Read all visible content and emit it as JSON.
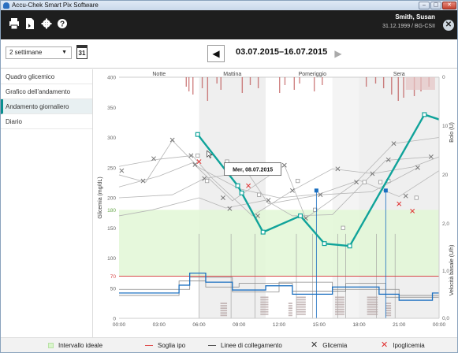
{
  "window": {
    "title": "Accu-Chek Smart Pix Software",
    "btn_min": "–",
    "btn_max": "▢",
    "btn_close": "✕"
  },
  "toolbar": {
    "icons": [
      "printer-icon",
      "pdf-export-icon",
      "gear-icon",
      "help-icon"
    ],
    "user_name": "Smith, Susan",
    "user_info": "31.12.1999 / BG-CSII"
  },
  "range": {
    "selected": "2 settimane",
    "calendar_label": "31",
    "date_range": "03.07.2015–16.07.2015"
  },
  "sidebar": {
    "items": [
      {
        "label": "Quadro glicemico"
      },
      {
        "label": "Grafico dell'andamento"
      },
      {
        "label": "Andamento giornaliero"
      },
      {
        "label": "Diario"
      }
    ],
    "active_index": 2
  },
  "chart_data": {
    "type": "line",
    "periods": [
      "Notte",
      "Mattina",
      "Pomeriggio",
      "Sera"
    ],
    "x_ticks": [
      "00:00",
      "03:00",
      "06:00",
      "09:00",
      "12:00",
      "15:00",
      "18:00",
      "21:00",
      "00:00"
    ],
    "xlim": [
      0,
      24
    ],
    "ylabel": "Glicemia (mg/dL)",
    "ylim": [
      0,
      400
    ],
    "y_ticks": [
      0,
      50,
      70,
      100,
      150,
      180,
      200,
      250,
      300,
      350,
      400
    ],
    "y2label": "Bolo (U)",
    "y2_ticks": [
      "0",
      "10",
      "20"
    ],
    "y3label": "Velocità basale (U/h)",
    "y3_ticks": [
      "2,0",
      "1,0",
      "0,0"
    ],
    "target_range": [
      70,
      180
    ],
    "hypo_threshold": 70,
    "highlighted_day": "Mer, 08.07.2015",
    "highlighted_series": [
      {
        "x": 5.9,
        "y": 305
      },
      {
        "x": 8.9,
        "y": 220
      },
      {
        "x": 9.2,
        "y": 208
      },
      {
        "x": 10.8,
        "y": 143
      },
      {
        "x": 13.6,
        "y": 170
      },
      {
        "x": 15.4,
        "y": 124
      },
      {
        "x": 17.3,
        "y": 120
      },
      {
        "x": 22.9,
        "y": 338
      },
      {
        "x": 24,
        "y": 330
      }
    ],
    "bg_readings": [
      {
        "x": 0.2,
        "y": 245
      },
      {
        "x": 1.8,
        "y": 228
      },
      {
        "x": 4.0,
        "y": 296
      },
      {
        "x": 5.4,
        "y": 270
      },
      {
        "x": 5.7,
        "y": 255
      },
      {
        "x": 6.4,
        "y": 232
      },
      {
        "x": 7.8,
        "y": 200
      },
      {
        "x": 8.3,
        "y": 182
      },
      {
        "x": 9.6,
        "y": 243
      },
      {
        "x": 11.2,
        "y": 196
      },
      {
        "x": 12.4,
        "y": 254
      },
      {
        "x": 13.0,
        "y": 212
      },
      {
        "x": 15.1,
        "y": 205
      },
      {
        "x": 16.4,
        "y": 248
      },
      {
        "x": 17.8,
        "y": 226
      },
      {
        "x": 19.0,
        "y": 240
      },
      {
        "x": 20.2,
        "y": 263
      },
      {
        "x": 20.6,
        "y": 290
      },
      {
        "x": 21.5,
        "y": 203
      },
      {
        "x": 22.4,
        "y": 250
      },
      {
        "x": 23.4,
        "y": 268
      },
      {
        "x": 2.6,
        "y": 265
      },
      {
        "x": 10.4,
        "y": 170
      },
      {
        "x": 14.0,
        "y": 166
      }
    ],
    "hypo_readings": [
      {
        "x": 6.0,
        "y": 260
      },
      {
        "x": 9.7,
        "y": 220
      },
      {
        "x": 21.0,
        "y": 190
      },
      {
        "x": 22.0,
        "y": 178
      }
    ],
    "basal_series": [
      {
        "x": 0,
        "y": 42
      },
      {
        "x": 4.5,
        "y": 42
      },
      {
        "x": 4.5,
        "y": 55
      },
      {
        "x": 5.3,
        "y": 55
      },
      {
        "x": 5.3,
        "y": 75
      },
      {
        "x": 6.5,
        "y": 75
      },
      {
        "x": 6.5,
        "y": 60
      },
      {
        "x": 8.5,
        "y": 60
      },
      {
        "x": 8.5,
        "y": 47
      },
      {
        "x": 11.0,
        "y": 47
      },
      {
        "x": 11.0,
        "y": 54
      },
      {
        "x": 13.0,
        "y": 54
      },
      {
        "x": 13.0,
        "y": 40
      },
      {
        "x": 16.0,
        "y": 40
      },
      {
        "x": 16.0,
        "y": 52
      },
      {
        "x": 19.5,
        "y": 52
      },
      {
        "x": 19.5,
        "y": 40
      },
      {
        "x": 21.0,
        "y": 40
      },
      {
        "x": 21.0,
        "y": 30
      },
      {
        "x": 23.5,
        "y": 30
      },
      {
        "x": 23.5,
        "y": 42
      },
      {
        "x": 24,
        "y": 42
      }
    ]
  },
  "tooltip": {
    "text": "Mer, 08.07.2015"
  },
  "legend": {
    "items": [
      {
        "label": "Intervallo ideale",
        "color": "#d9f5cc"
      },
      {
        "label": "Soglia ipo",
        "color": "#e05050"
      },
      {
        "label": "Linee di collegamento",
        "color": "#555555"
      },
      {
        "label": "Glicemia",
        "color": "#333333"
      },
      {
        "label": "Ipoglicemia",
        "color": "#e03030"
      }
    ]
  },
  "colors": {
    "accent": "#10a39a",
    "basal": "#1a6fc0",
    "target": "#e2f7d6",
    "hypo_line": "#d84a4a"
  }
}
